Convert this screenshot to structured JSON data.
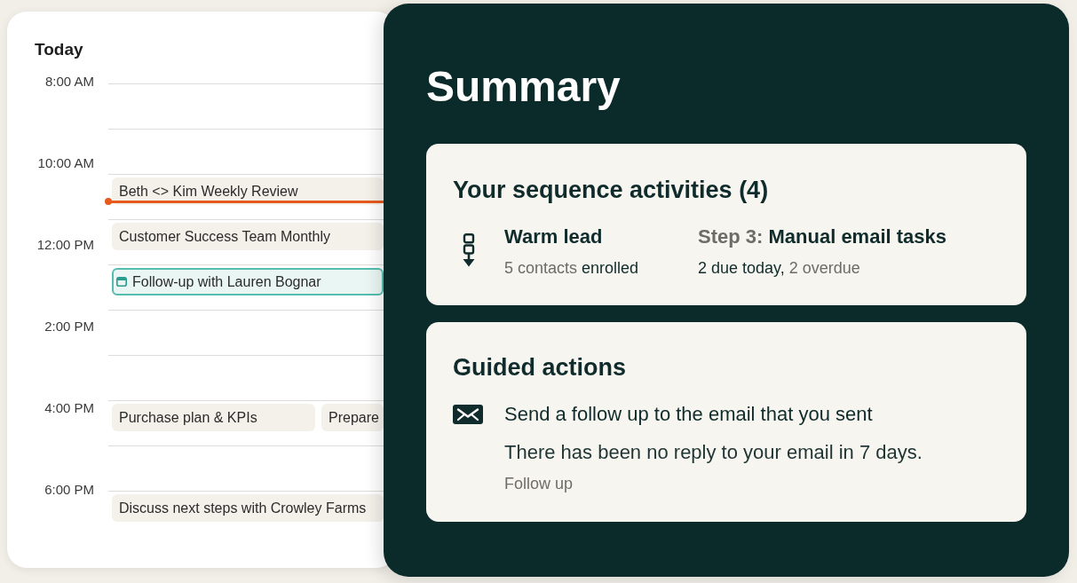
{
  "calendar": {
    "title": "Today",
    "time_labels": [
      "8:00 AM",
      "10:00 AM",
      "12:00 PM",
      "2:00 PM",
      "4:00 PM",
      "6:00 PM"
    ],
    "rows": [
      {
        "current_time": false
      },
      {
        "current_time": false
      },
      {
        "current_time": true,
        "events": [
          {
            "kind": "meeting",
            "title": "Beth <> Kim Weekly Review"
          }
        ]
      },
      {
        "current_time": false,
        "events": [
          {
            "kind": "meeting",
            "title": "Customer Success Team Monthly"
          }
        ]
      },
      {
        "current_time": false,
        "events": [
          {
            "kind": "task",
            "title": "Follow-up with Lauren Bognar"
          }
        ]
      },
      {
        "current_time": false
      },
      {
        "current_time": false
      },
      {
        "current_time": false,
        "events": [
          {
            "kind": "meeting",
            "title": "Purchase plan & KPIs"
          },
          {
            "kind": "meeting",
            "title": "Prepare"
          }
        ]
      },
      {
        "current_time": false
      },
      {
        "current_time": false,
        "events": [
          {
            "kind": "meeting",
            "title": "Discuss next steps with Crowley Farms"
          }
        ]
      }
    ]
  },
  "summary": {
    "title": "Summary",
    "sequence_card": {
      "title": "Your sequence activities (4)",
      "sequence": {
        "name": "Warm lead",
        "count": "5 contacts",
        "status": "enrolled"
      },
      "step": {
        "label": "Step 3:",
        "name": "Manual email tasks",
        "due": "2 due today,",
        "overdue": "2 overdue"
      }
    },
    "guided_card": {
      "title": "Guided actions",
      "action": {
        "title": "Send a follow up to the email that you sent",
        "description": "There has been no reply to your email in 7 days.",
        "link": "Follow up"
      }
    }
  }
}
